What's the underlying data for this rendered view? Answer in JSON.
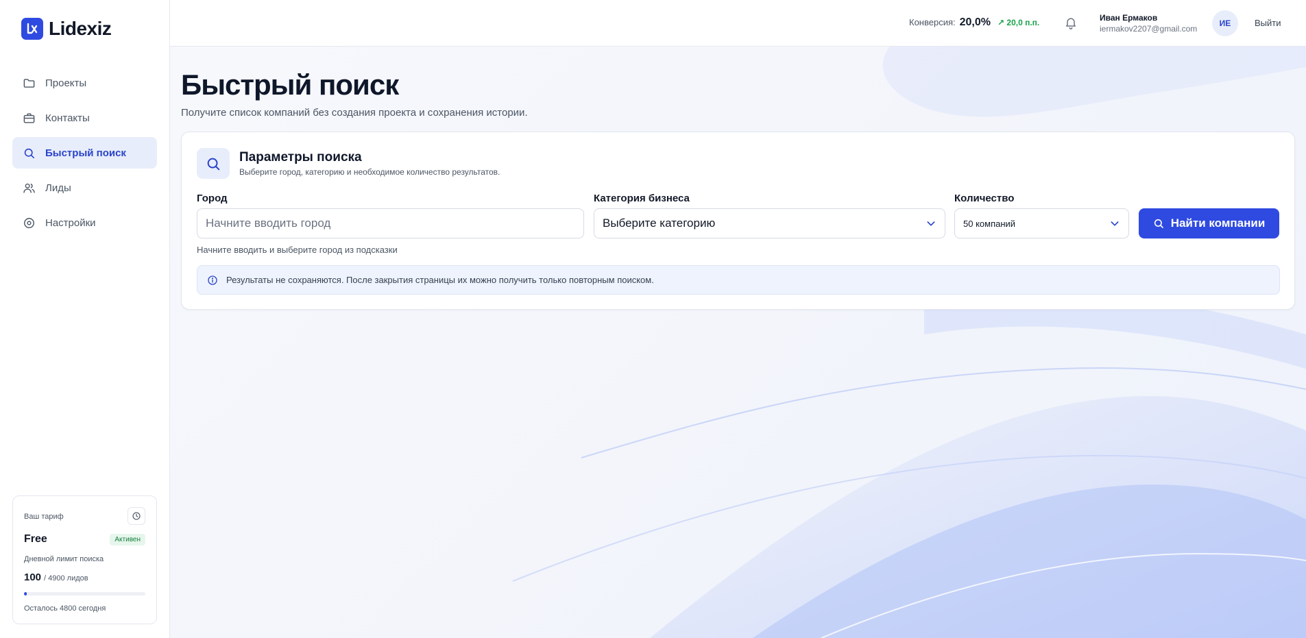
{
  "brand": {
    "name": "Lidexiz",
    "color": "#2f4ae0"
  },
  "sidebar": {
    "items": [
      {
        "label": "Проекты",
        "icon": "folder-icon",
        "active": false
      },
      {
        "label": "Контакты",
        "icon": "briefcase-icon",
        "active": false
      },
      {
        "label": "Быстрый поиск",
        "icon": "search-icon",
        "active": true
      },
      {
        "label": "Лиды",
        "icon": "users-icon",
        "active": false
      },
      {
        "label": "Настройки",
        "icon": "settings-icon",
        "active": false
      }
    ]
  },
  "plan": {
    "caption": "Ваш тариф",
    "name": "Free",
    "status": "Активен",
    "limit_label": "Дневной лимит поиска",
    "used": "100",
    "total": "/ 4900 лидов",
    "used_fraction": 0.02,
    "remaining": "Осталось 4800 сегодня"
  },
  "header": {
    "conversion_label": "Конверсия:",
    "conversion_value": "20,0%",
    "conversion_delta": "↗ 20,0 п.п.",
    "user_name": "Иван Ермаков",
    "user_email": "iermakov2207@gmail.com",
    "avatar_initials": "ИЕ",
    "logout": "Выйти"
  },
  "page": {
    "title": "Быстрый поиск",
    "subtitle": "Получите список компаний без создания проекта и сохранения истории."
  },
  "search": {
    "title": "Параметры поиска",
    "subtitle": "Выберите город, категорию и необходимое количество результатов.",
    "city_label": "Город",
    "city_placeholder": "Начните вводить город",
    "city_hint": "Начните вводить и выберите город из подсказки",
    "category_label": "Категория бизнеса",
    "category_value": "Выберите категорию",
    "count_label": "Количество",
    "count_value": "50 компаний",
    "button_label": "Найти компании",
    "notice": "Результаты не сохраняются. После закрытия страницы их можно получить только повторным поиском."
  }
}
